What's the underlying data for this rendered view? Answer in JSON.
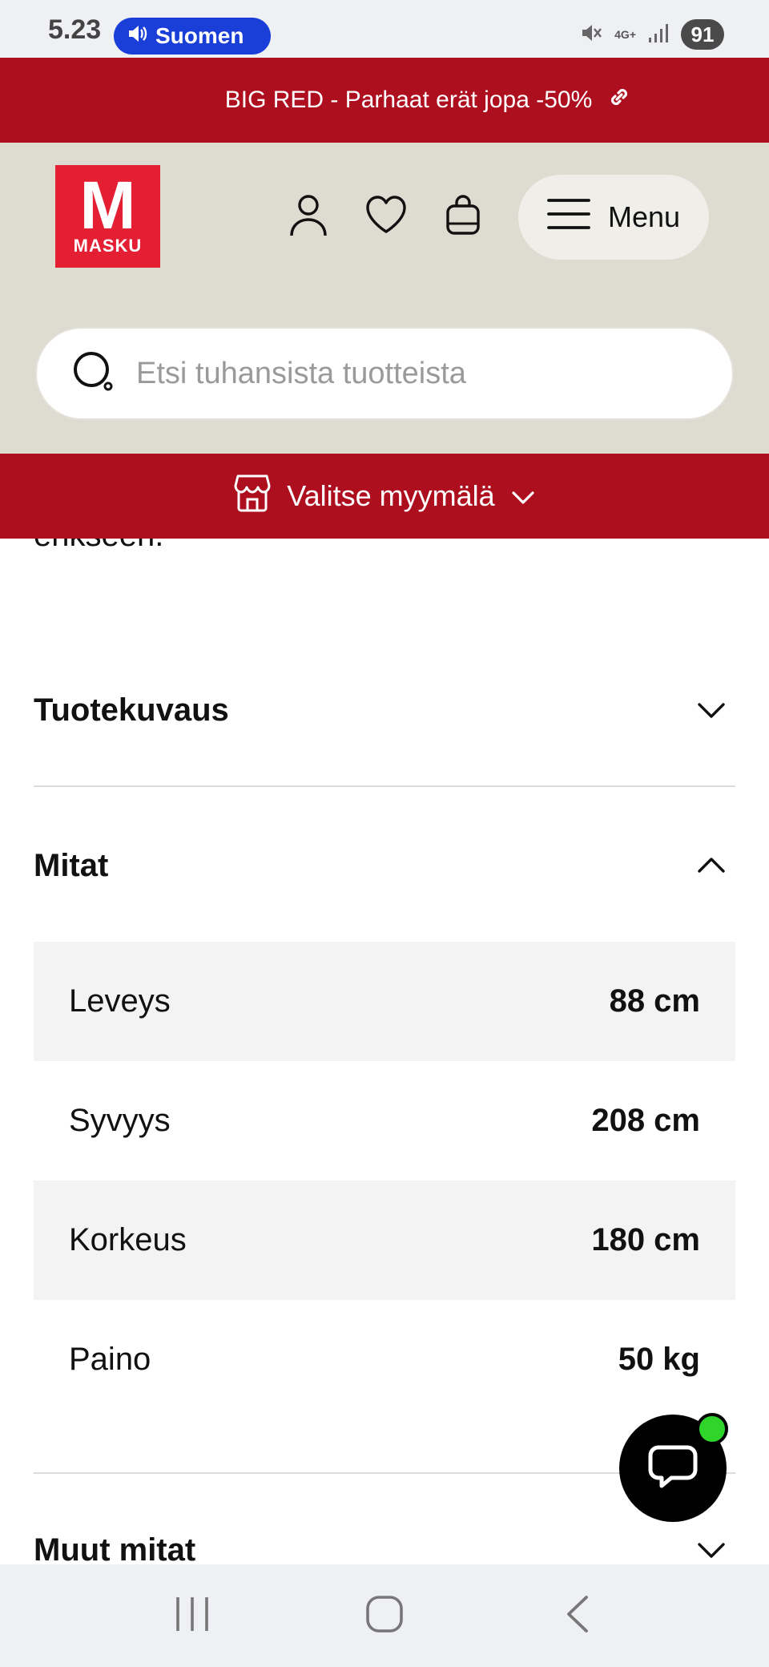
{
  "status_bar": {
    "time": "5.23",
    "media_label": "Suomen",
    "network": "4G+",
    "battery": "91"
  },
  "promo": {
    "text": "BIG RED - Parhaat erät jopa -50%"
  },
  "header": {
    "logo_text": "MASKU",
    "logo_letter": "M",
    "menu_label": "Menu"
  },
  "search": {
    "placeholder": "Etsi tuhansista tuotteista",
    "value": ""
  },
  "store": {
    "label": "Valitse myymälä"
  },
  "content": {
    "cut_text": "erikseen.",
    "sections": [
      {
        "title": "Tuotekuvaus",
        "expanded": false
      },
      {
        "title": "Mitat",
        "expanded": true
      },
      {
        "title": "Muut mitat",
        "expanded": false
      }
    ],
    "dimensions": [
      {
        "label": "Leveys",
        "value": "88 cm"
      },
      {
        "label": "Syvyys",
        "value": "208 cm"
      },
      {
        "label": "Korkeus",
        "value": "180 cm"
      },
      {
        "label": "Paino",
        "value": "50 kg"
      }
    ]
  },
  "colors": {
    "brand_red": "#ad0f1f",
    "logo_red": "#e41f33",
    "header_beige": "#dedbd1",
    "chat_online": "#2fd52a"
  },
  "icons": [
    "speaker-icon",
    "mute-icon",
    "signal-icon",
    "link-icon",
    "user-icon",
    "heart-icon",
    "bag-icon",
    "hamburger-icon",
    "search-icon",
    "store-icon",
    "chevron-down-icon",
    "chevron-up-icon",
    "chat-icon",
    "recents-icon",
    "home-icon",
    "back-icon"
  ]
}
